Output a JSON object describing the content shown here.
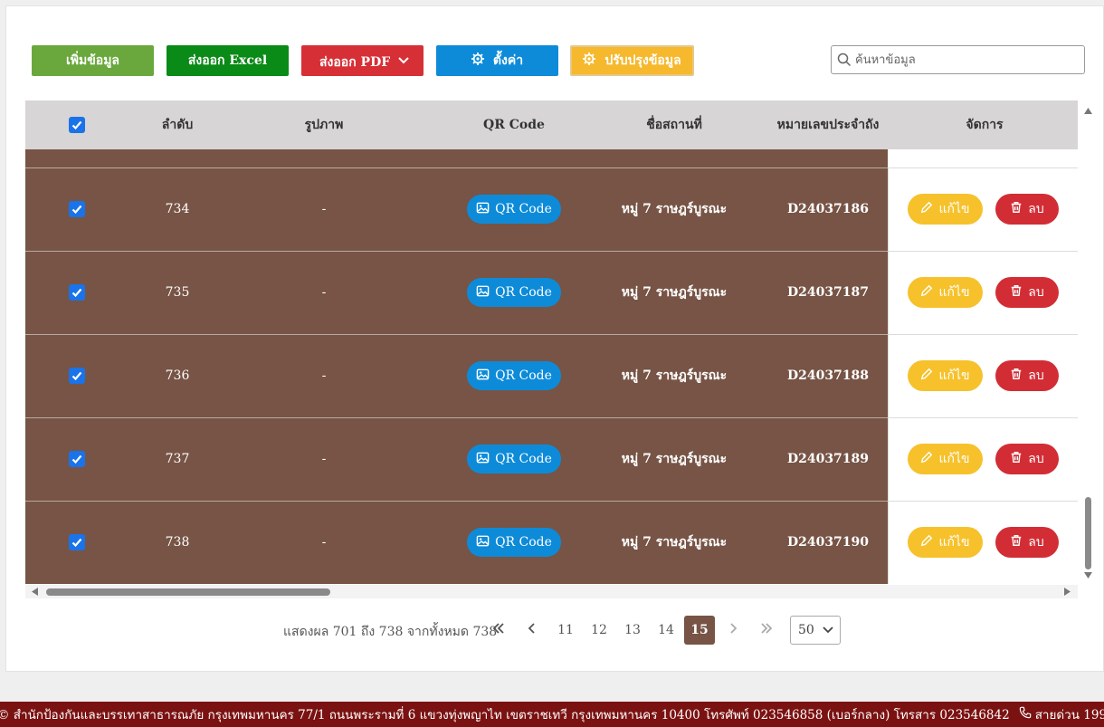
{
  "toolbar": {
    "add_label": "เพิ่มข้อมูล",
    "excel_label": "ส่งออก Excel",
    "pdf_label": "ส่งออก PDF",
    "settings_label": "ตั้งค่า",
    "update_label": "ปรับปรุงข้อมูล"
  },
  "search": {
    "placeholder": "ค้นหาข้อมูล"
  },
  "table": {
    "columns": [
      "ลำดับ",
      "รูปภาพ",
      "QR Code",
      "ชื่อสถานที่",
      "หมายเลขประจำถัง",
      "จัดการ"
    ],
    "rows": [
      {
        "no": "734",
        "image": "-",
        "qr": "QR Code",
        "place": "หมู่ 7 ราษฎร์บูรณะ",
        "tank_id": "D24037186",
        "edit": "แก้ไข",
        "delete": "ลบ"
      },
      {
        "no": "735",
        "image": "-",
        "qr": "QR Code",
        "place": "หมู่ 7 ราษฎร์บูรณะ",
        "tank_id": "D24037187",
        "edit": "แก้ไข",
        "delete": "ลบ"
      },
      {
        "no": "736",
        "image": "-",
        "qr": "QR Code",
        "place": "หมู่ 7 ราษฎร์บูรณะ",
        "tank_id": "D24037188",
        "edit": "แก้ไข",
        "delete": "ลบ"
      },
      {
        "no": "737",
        "image": "-",
        "qr": "QR Code",
        "place": "หมู่ 7 ราษฎร์บูรณะ",
        "tank_id": "D24037189",
        "edit": "แก้ไข",
        "delete": "ลบ"
      },
      {
        "no": "738",
        "image": "-",
        "qr": "QR Code",
        "place": "หมู่ 7 ราษฎร์บูรณะ",
        "tank_id": "D24037190",
        "edit": "แก้ไข",
        "delete": "ลบ"
      }
    ]
  },
  "pagination": {
    "info": "แสดงผล 701 ถึง 738 จากทั้งหมด 738",
    "pages": [
      "11",
      "12",
      "13",
      "14",
      "15"
    ],
    "current": "15",
    "page_size": "50"
  },
  "footer": {
    "text": "© สำนักป้องกันและบรรเทาสาธารณภัย กรุงเทพมหานคร 77/1 ถนนพระรามที่ 6 แขวงทุ่งพญาไท เขตราชเทวี กรุงเทพมหานคร 10400 โทรศัพท์ 023546858 (เบอร์กลาง) โทรสาร 023546842",
    "hotline": "สายด่วน 199"
  },
  "colors": {
    "row_selected": "#775445",
    "add": "#6aa83d",
    "excel": "#0a8a17",
    "pdf": "#d63036",
    "settings": "#0d8bd9",
    "update": "#f6b82d",
    "footer": "#7b1212"
  }
}
